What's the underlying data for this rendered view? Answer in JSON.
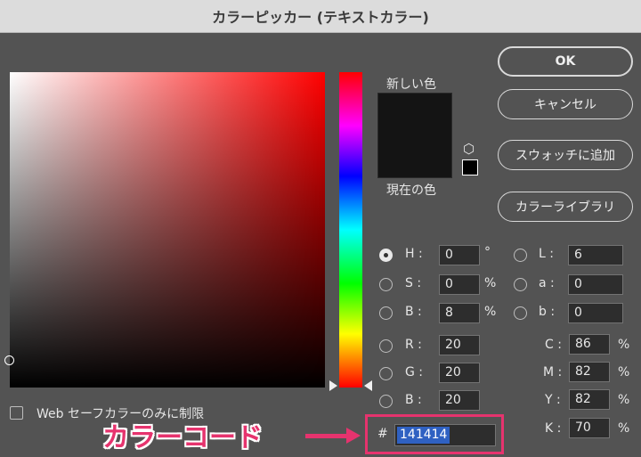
{
  "window": {
    "title": "カラーピッカー (テキストカラー)"
  },
  "colors": {
    "current": "#141414",
    "hex_highlight": "#2f61c2",
    "annotation": "#e6336e"
  },
  "swatch": {
    "new_label": "新しい色",
    "current_label": "現在の色",
    "cube_icon": "cube-icon"
  },
  "buttons": {
    "ok": "OK",
    "cancel": "キャンセル",
    "add_swatch": "スウォッチに追加",
    "library": "カラーライブラリ"
  },
  "hsb": {
    "h": {
      "label": "H :",
      "value": "0",
      "unit": "°",
      "selected": true
    },
    "s": {
      "label": "S :",
      "value": "0",
      "unit": "%"
    },
    "b": {
      "label": "B :",
      "value": "8",
      "unit": "%"
    }
  },
  "lab": {
    "l": {
      "label": "L :",
      "value": "6"
    },
    "a": {
      "label": "a :",
      "value": "0"
    },
    "b": {
      "label": "b :",
      "value": "0"
    }
  },
  "rgb": {
    "r": {
      "label": "R :",
      "value": "20"
    },
    "g": {
      "label": "G :",
      "value": "20"
    },
    "b": {
      "label": "B :",
      "value": "20"
    }
  },
  "cmyk": {
    "c": {
      "label": "C :",
      "value": "86",
      "unit": "%"
    },
    "m": {
      "label": "M :",
      "value": "82",
      "unit": "%"
    },
    "y": {
      "label": "Y :",
      "value": "82",
      "unit": "%"
    },
    "k": {
      "label": "K :",
      "value": "70",
      "unit": "%"
    }
  },
  "hex": {
    "prefix": "#",
    "value": "141414"
  },
  "web_safe_label": "Web セーフカラーのみに制限",
  "annotation": {
    "text": "カラーコード"
  }
}
